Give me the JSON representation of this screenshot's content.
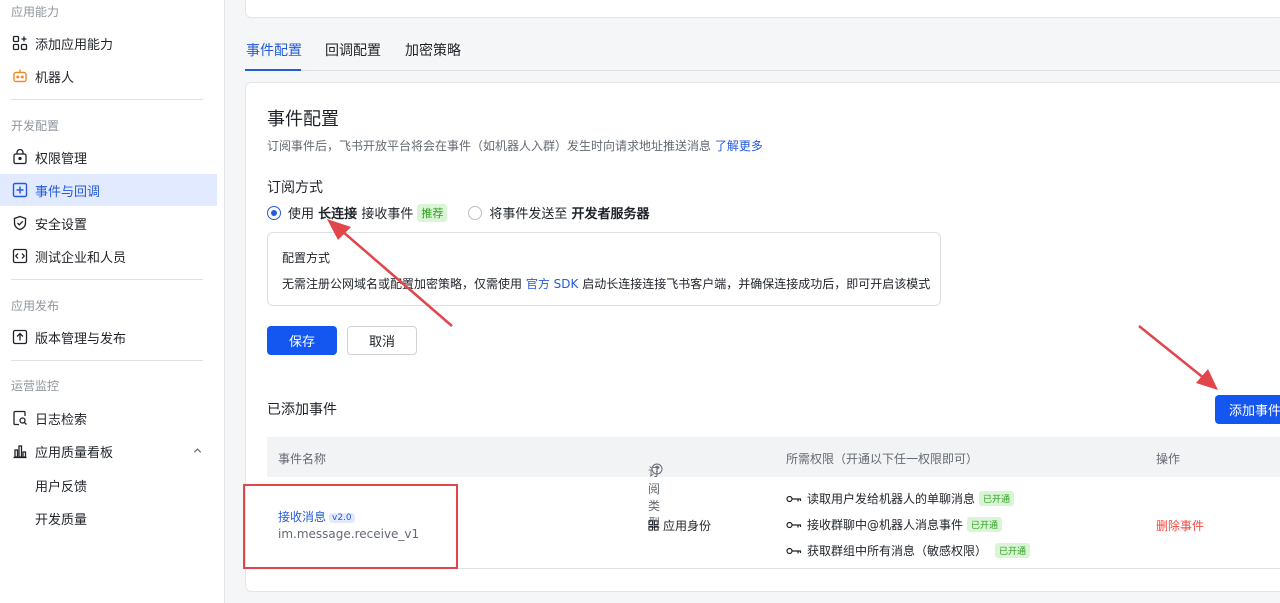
{
  "sidebar": {
    "sections": [
      {
        "title": "应用能力"
      },
      {
        "title": "开发配置"
      },
      {
        "title": "应用发布"
      },
      {
        "title": "运营监控"
      }
    ],
    "items": [
      {
        "label": "添加应用能力"
      },
      {
        "label": "机器人"
      },
      {
        "label": "权限管理"
      },
      {
        "label": "事件与回调"
      },
      {
        "label": "安全设置"
      },
      {
        "label": "测试企业和人员"
      },
      {
        "label": "版本管理与发布"
      },
      {
        "label": "日志检索"
      },
      {
        "label": "应用质量看板"
      },
      {
        "label": "用户反馈"
      },
      {
        "label": "开发质量"
      }
    ]
  },
  "tabs": [
    {
      "label": "事件配置"
    },
    {
      "label": "回调配置"
    },
    {
      "label": "加密策略"
    }
  ],
  "event_config": {
    "title": "事件配置",
    "desc": "订阅事件后，飞书开放平台将会在事件（如机器人入群）发生时向请求地址推送消息",
    "learn_more": "了解更多",
    "subscribe_title": "订阅方式",
    "opt1_pre": "使用",
    "opt1_bold": "长连接",
    "opt1_post": "接收事件",
    "opt1_tag": "推荐",
    "opt2_pre": "将事件发送至",
    "opt2_bold": "开发者服务器",
    "cfg_title": "配置方式",
    "cfg_text_pre": "无需注册公网域名或配置加密策略，仅需使用",
    "cfg_link": "官方 SDK",
    "cfg_text_post": "启动长连接连接飞书客户端，并确保连接成功后，即可开启该模式",
    "save": "保存",
    "cancel": "取消"
  },
  "added_events": {
    "title": "已添加事件",
    "add_button": "添加事件",
    "columns": {
      "name": "事件名称",
      "type": "订阅类型",
      "perm": "所需权限（开通以下任一权限即可）",
      "action": "操作"
    },
    "rows": [
      {
        "name": "接收消息",
        "version": "v2.0",
        "key": "im.message.receive_v1",
        "type": "应用身份",
        "perms": [
          {
            "label": "读取用户发给机器人的单聊消息",
            "status": "已开通"
          },
          {
            "label": "接收群聊中@机器人消息事件",
            "status": "已开通"
          },
          {
            "label": "获取群组中所有消息（敏感权限）",
            "status": "已开通"
          }
        ],
        "action": "删除事件"
      }
    ]
  },
  "colors": {
    "primary": "#1456f0",
    "link": "#245bdb",
    "danger": "#f54a45",
    "success": "#2ea121",
    "annotation": "#e0464a"
  }
}
